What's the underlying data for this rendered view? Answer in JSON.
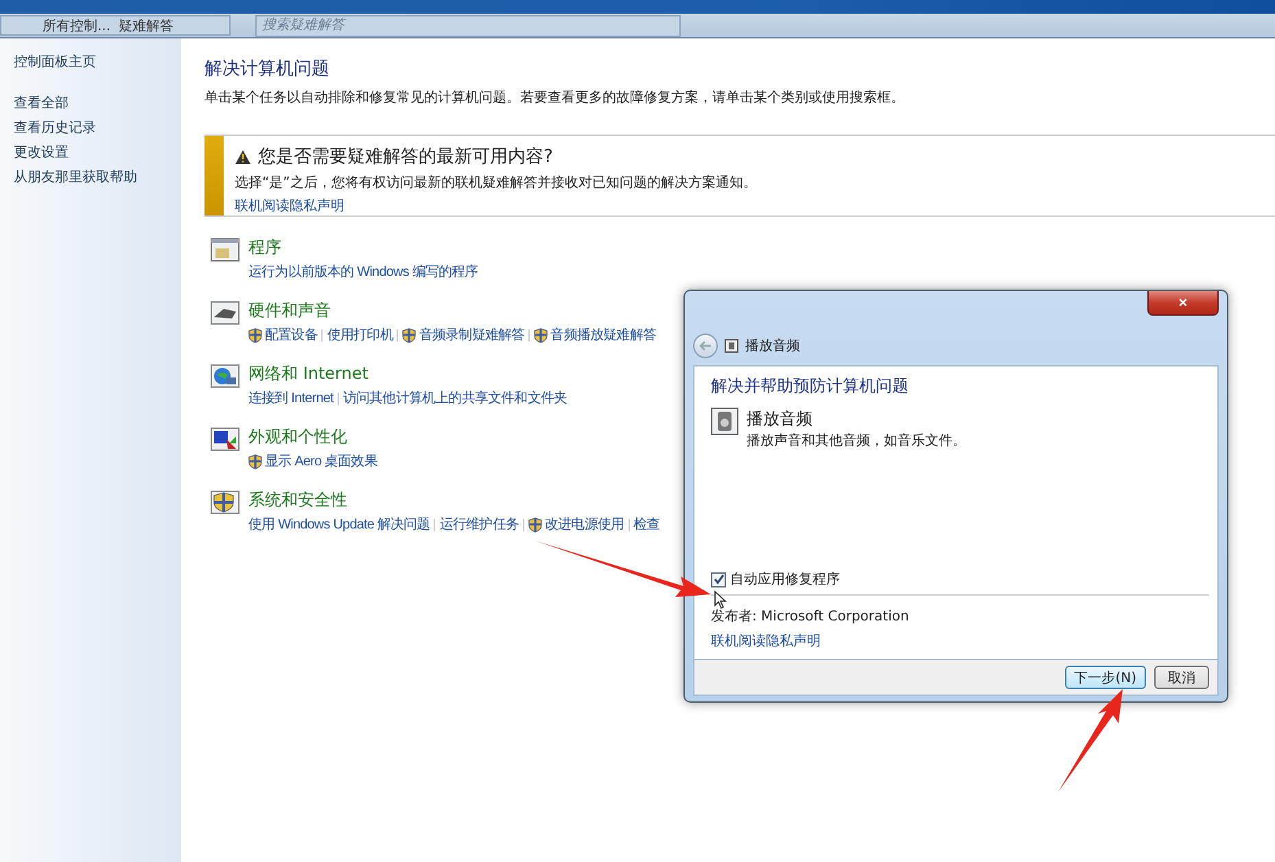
{
  "address_bar": {
    "crumbs": [
      "所有控制...",
      "疑难解答"
    ],
    "search": {
      "placeholder": "搜索疑难解答"
    }
  },
  "sidebar": {
    "items": [
      {
        "label": "控制面板主页",
        "kind": "home"
      },
      {
        "label": "查看全部",
        "kind": "link"
      },
      {
        "label": "查看历史记录",
        "kind": "link"
      },
      {
        "label": "更改设置",
        "kind": "link"
      },
      {
        "label": "从朋友那里获取帮助",
        "kind": "link"
      }
    ]
  },
  "header": {
    "title": "解决计算机问题",
    "description": "单击某个任务以自动排除和修复常见的计算机问题。若要查看更多的故障修复方案，请单击某个类别或使用搜索框。"
  },
  "notice": {
    "title": "您是否需要疑难解答的最新可用内容?",
    "text": "选择“是”之后，您将有权访问最新的联机疑难解答并接收对已知问题的解决方案通知。",
    "link": "联机阅读隐私声明"
  },
  "categories": [
    {
      "title": "程序",
      "kind": "programs",
      "links": [
        {
          "label": "运行为以前版本的 Windows 编写的程序",
          "shield": false
        }
      ]
    },
    {
      "title": "硬件和声音",
      "kind": "hardware",
      "links": [
        {
          "label": "配置设备",
          "shield": true
        },
        {
          "label": "使用打印机",
          "shield": false
        },
        {
          "label": "音频录制疑难解答",
          "shield": true
        },
        {
          "label": "音频播放疑难解答",
          "shield": true
        }
      ]
    },
    {
      "title": "网络和 Internet",
      "kind": "network",
      "links": [
        {
          "label": "连接到 Internet",
          "shield": false
        },
        {
          "label": "访问其他计算机上的共享文件和文件夹",
          "shield": false
        }
      ]
    },
    {
      "title": "外观和个性化",
      "kind": "appearance",
      "links": [
        {
          "label": "显示 Aero 桌面效果",
          "shield": true
        }
      ]
    },
    {
      "title": "系统和安全性",
      "kind": "system",
      "links": [
        {
          "label": "使用 Windows Update 解决问题",
          "shield": false
        },
        {
          "label": "运行维护任务",
          "shield": false
        },
        {
          "label": "改进电源使用",
          "shield": true
        },
        {
          "label": "检查",
          "shield": false
        }
      ]
    }
  ],
  "dialog": {
    "close": "×",
    "nav_title": "播放音频",
    "heading": "解决并帮助预防计算机问题",
    "item_title": "播放音频",
    "item_text": "播放声音和其他音频，如音乐文件。",
    "checkbox": {
      "label": "自动应用修复程序",
      "checked": true
    },
    "publisher": "发布者:  Microsoft Corporation",
    "privacy_link": "联机阅读隐私声明",
    "buttons": [
      {
        "label": "下一步(N)",
        "default": true
      },
      {
        "label": "取消",
        "default": false
      }
    ]
  }
}
